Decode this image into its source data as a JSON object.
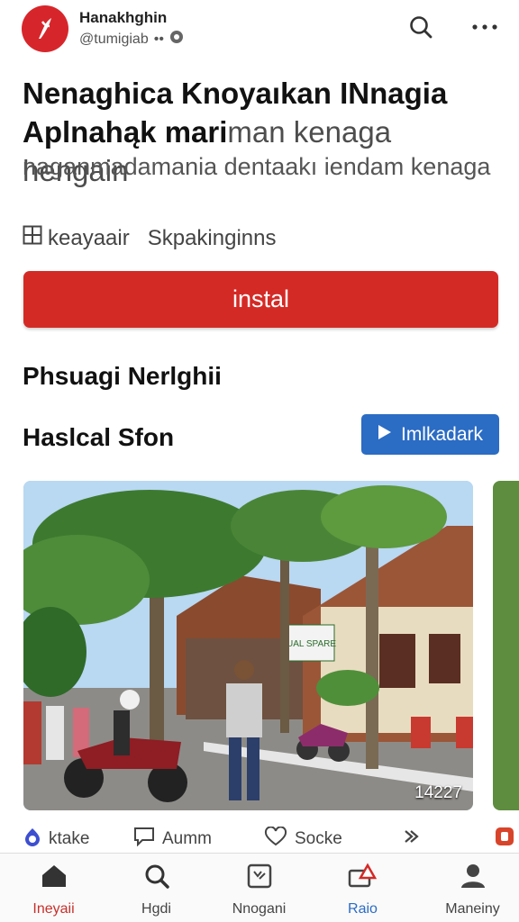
{
  "header": {
    "account_name": "Hanakhghin",
    "handle": "@tumigiab",
    "handle_dots": "••",
    "icons": {
      "search": "search-icon",
      "more": "more-icon",
      "logo": "app-logo-icon"
    }
  },
  "app": {
    "title_bold": "Nenaghica Knoyaıkan INnagia Aplnahąk mari",
    "title_rest": "man kenaga hengain",
    "subtitle": "naganmadamania dentaakı iendam kenaga",
    "meta_1": "keayaair",
    "meta_2": "Skpakinginns",
    "install_label": "instal"
  },
  "sections": {
    "heading_1": "Phsuagi Nerlghii",
    "heading_2": "Haslcal Sfon",
    "play_label": "Imlkadark"
  },
  "card": {
    "count": "14227",
    "shop_sign": "JUAL SPARE"
  },
  "actions": [
    {
      "label": "ktake",
      "icon": "shield-icon"
    },
    {
      "label": "Aumm",
      "icon": "comment-icon"
    },
    {
      "label": "Socke",
      "icon": "heart-icon"
    },
    {
      "label": "",
      "icon": "share-icon"
    }
  ],
  "nav": [
    {
      "label": "Ineyaii",
      "icon": "home-icon"
    },
    {
      "label": "Hgdi",
      "icon": "search-icon"
    },
    {
      "label": "Nnogani",
      "icon": "apps-icon"
    },
    {
      "label": "Raio",
      "icon": "alert-tv-icon"
    },
    {
      "label": "Maneiny",
      "icon": "profile-icon"
    }
  ],
  "colors": {
    "brand_red": "#d42a26",
    "accent_blue": "#2b6cc4",
    "active_nav": "#c8302b"
  }
}
